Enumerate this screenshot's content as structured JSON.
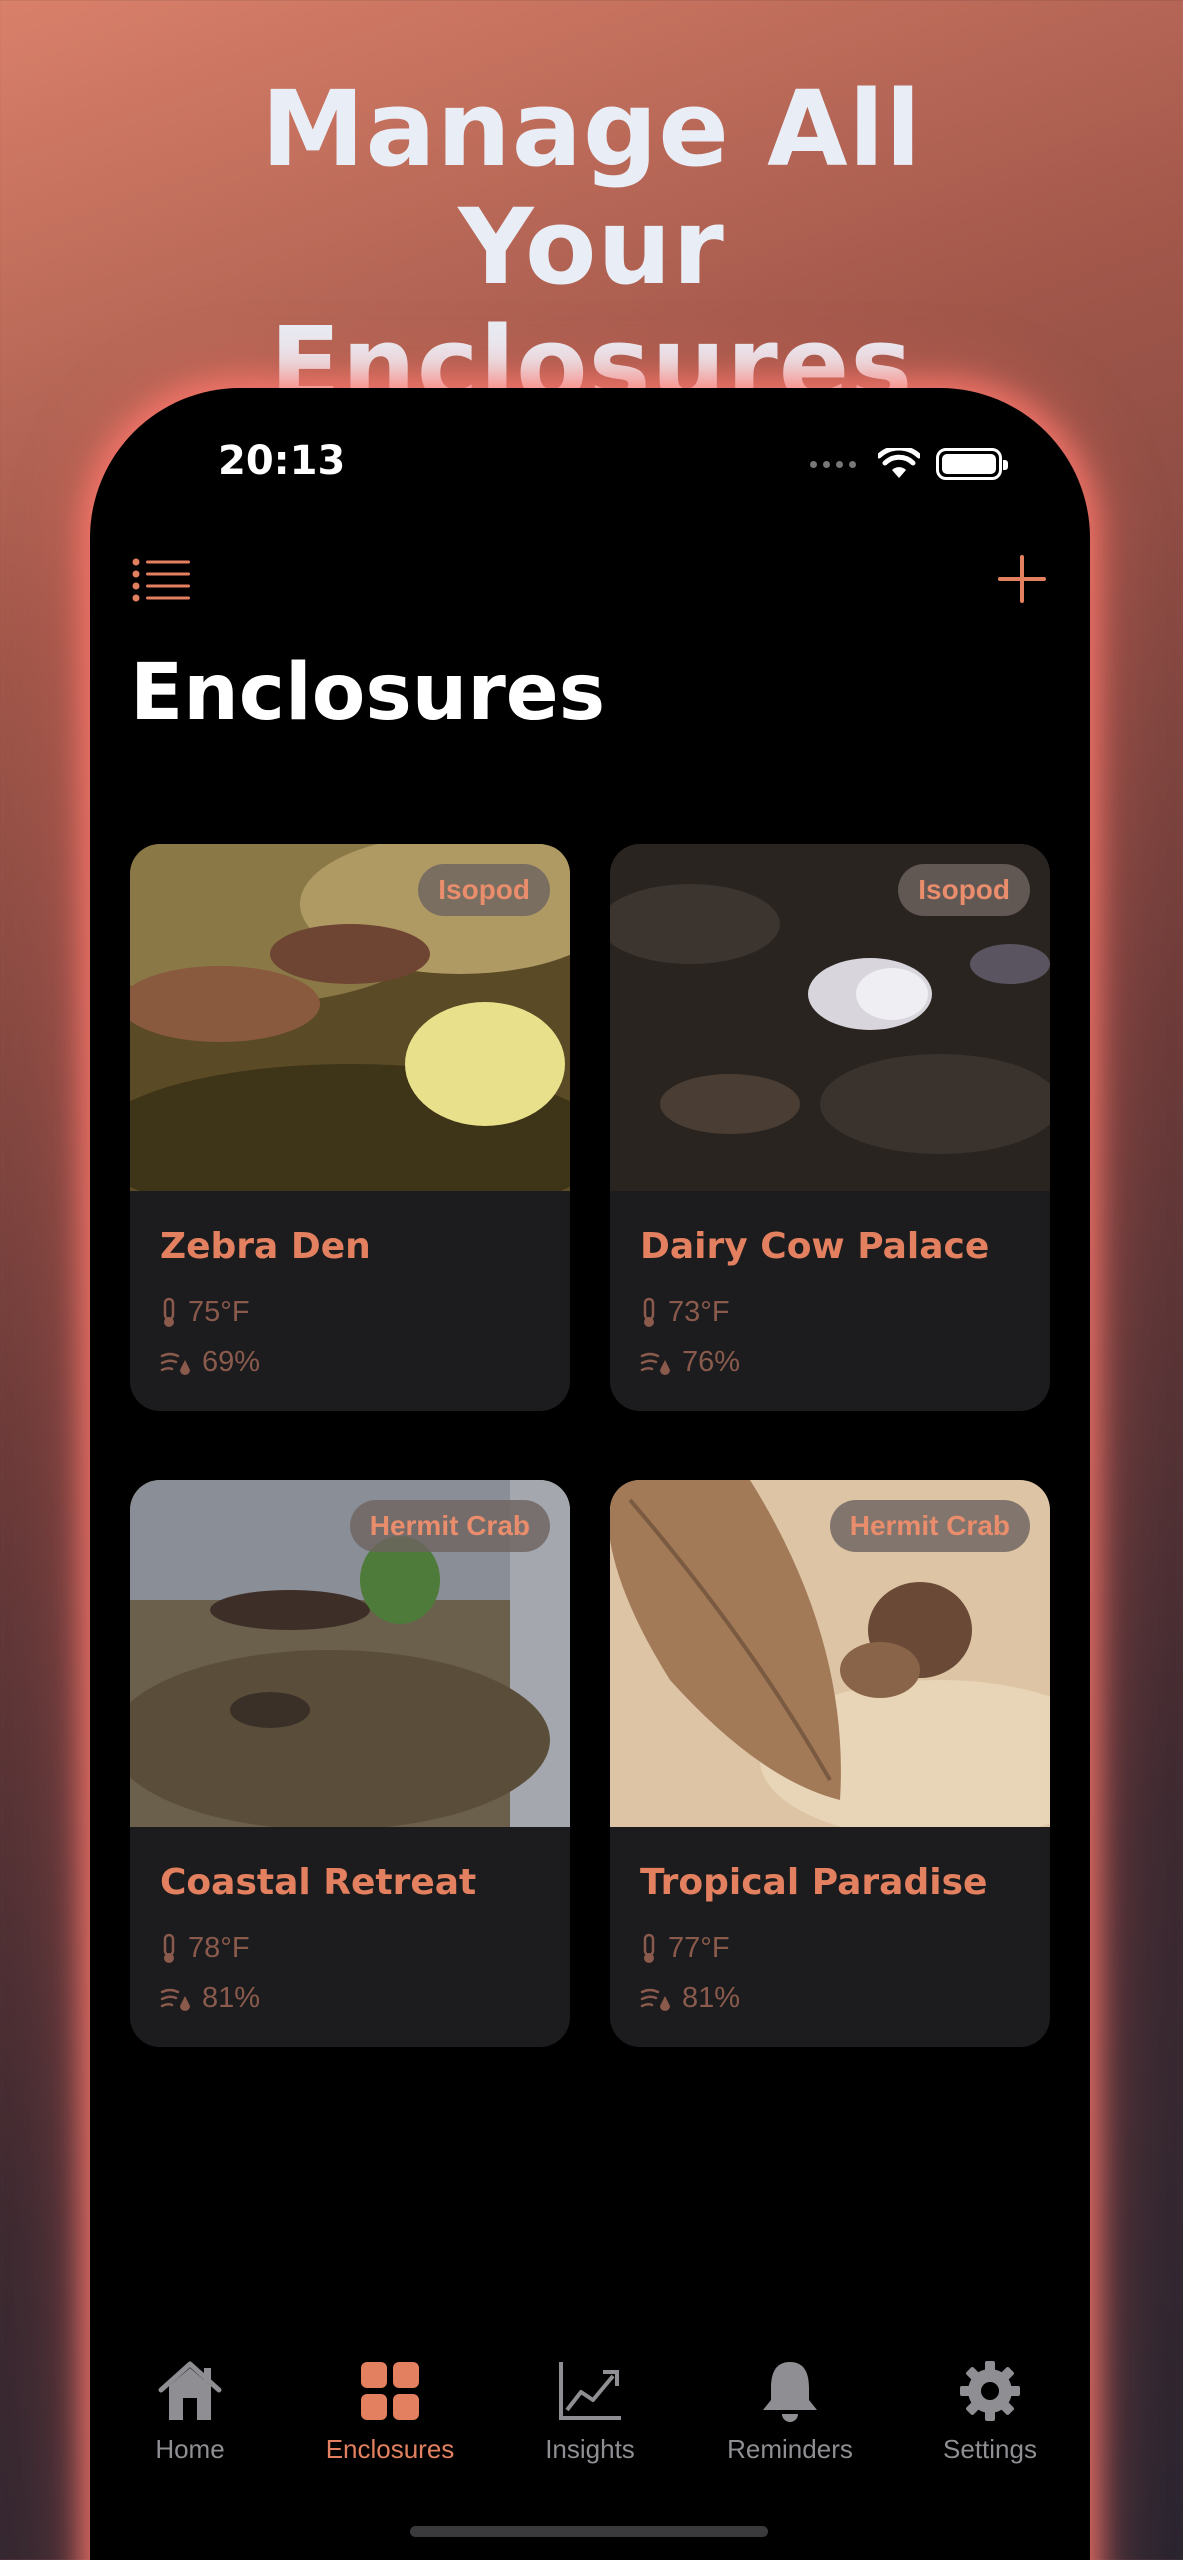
{
  "headline": "Manage All Your Enclosures",
  "status_bar": {
    "time": "20:13"
  },
  "page_title": "Enclosures",
  "enclosures": [
    {
      "name": "Zebra Den",
      "species": "Isopod",
      "temperature": "75°F",
      "humidity": "69%"
    },
    {
      "name": "Dairy Cow Palace",
      "species": "Isopod",
      "temperature": "73°F",
      "humidity": "76%"
    },
    {
      "name": "Coastal Retreat",
      "species": "Hermit Crab",
      "temperature": "78°F",
      "humidity": "81%"
    },
    {
      "name": "Tropical Paradise",
      "species": "Hermit Crab",
      "temperature": "77°F",
      "humidity": "81%"
    }
  ],
  "tab_bar": {
    "active": "Enclosures",
    "tabs": [
      {
        "label": "Home",
        "icon": "home-icon"
      },
      {
        "label": "Enclosures",
        "icon": "grid-icon"
      },
      {
        "label": "Insights",
        "icon": "chart-icon"
      },
      {
        "label": "Reminders",
        "icon": "bell-icon"
      },
      {
        "label": "Settings",
        "icon": "gear-icon"
      }
    ]
  },
  "colors": {
    "accent": "#e3805f",
    "card_background": "#1c1c1e",
    "inactive_tab": "#8e8e93"
  }
}
